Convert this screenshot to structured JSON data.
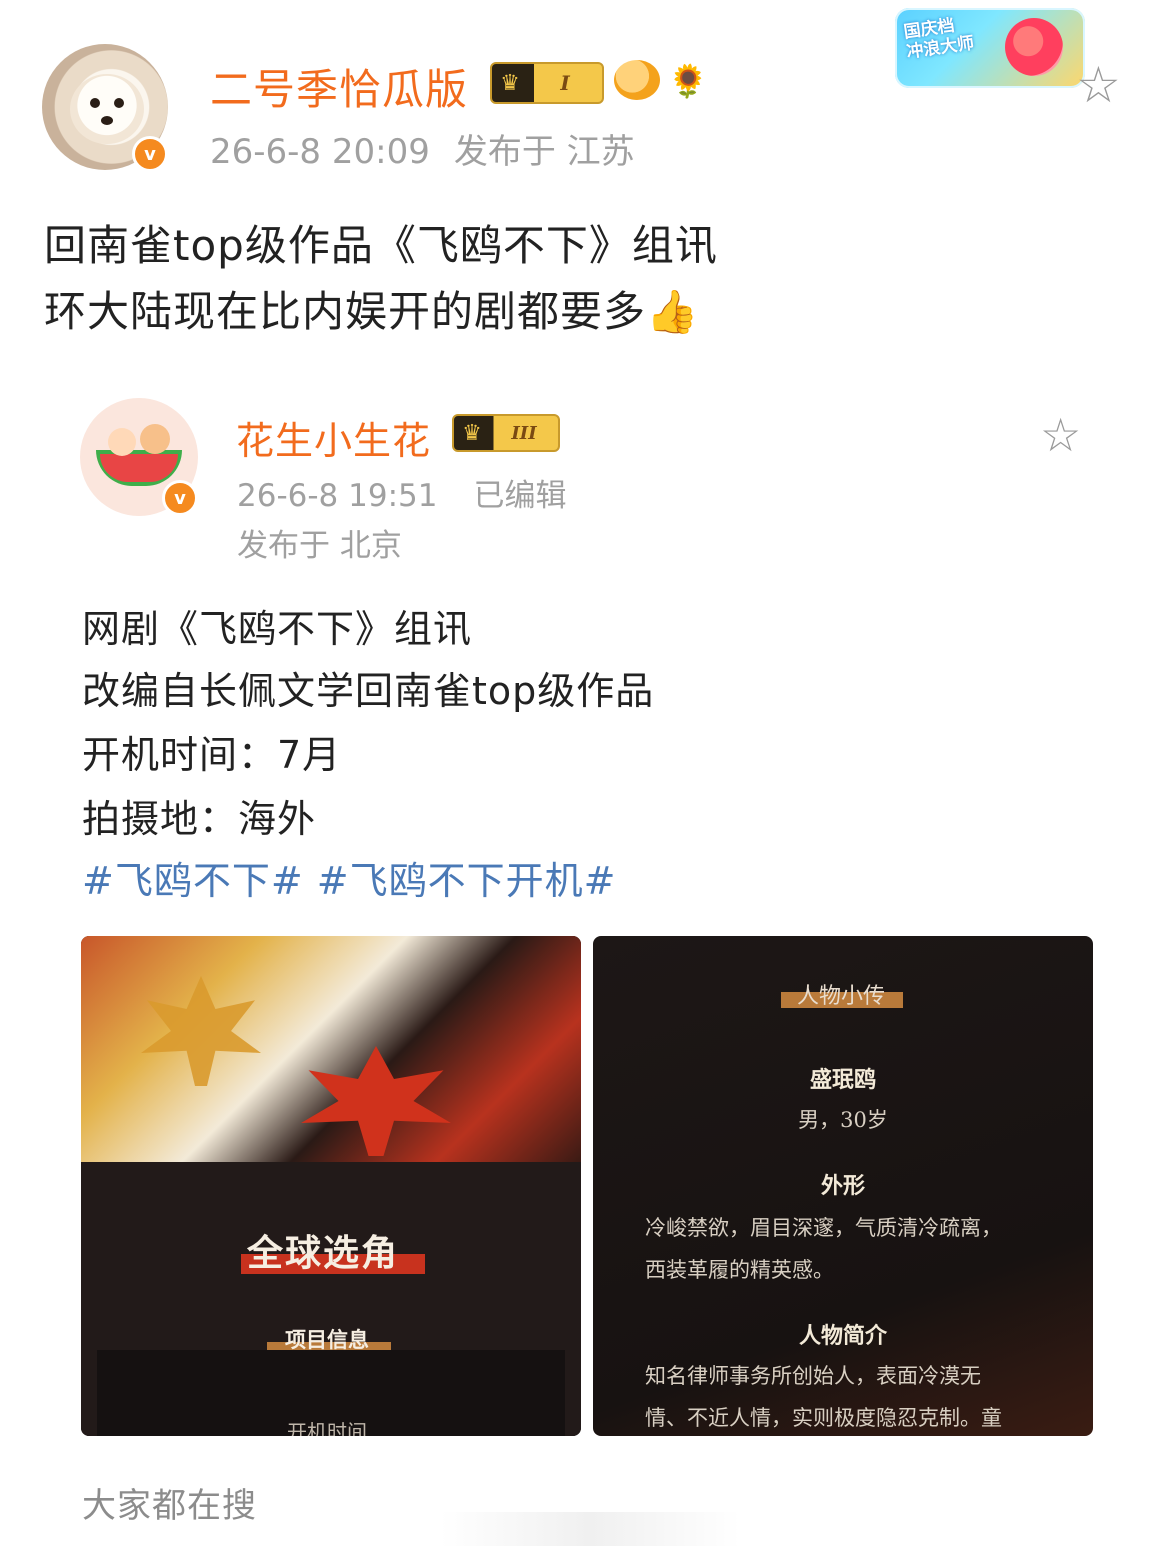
{
  "post": {
    "username": "二号季恰瓜版",
    "level_badge": "I",
    "timestamp": "26-6-8 20:09",
    "location": "发布于 江苏",
    "text_line1": "回南雀top级作品《飞鸥不下》组讯",
    "text_line2": "环大陆现在比内娱开的剧都要多",
    "emoji": "👍",
    "verify_mark": "v"
  },
  "promo": {
    "text_line1": "国庆档",
    "text_line2": "冲浪大师"
  },
  "repost": {
    "username": "花生小生花",
    "level_badge": "III",
    "timestamp": "26-6-8 19:51",
    "edited": "已编辑",
    "location": "发布于 北京",
    "lines": [
      "网剧《飞鸥不下》组讯",
      "改编自长佩文学回南雀top级作品",
      "开机时间：7月",
      "拍摄地：海外"
    ],
    "hashtags": [
      "#飞鸥不下#",
      "#飞鸥不下开机#"
    ],
    "verify_mark": "v"
  },
  "image_left": {
    "title": "全球选角",
    "section": "项目信息",
    "partial_text": "开机时间"
  },
  "image_right": {
    "section": "人物小传",
    "character_name": "盛珉鸥",
    "character_info": "男，30岁",
    "appearance_heading": "外形",
    "appearance_line1": "冷峻禁欲，眉目深邃，气质清冷疏离，",
    "appearance_line2": "西装革履的精英感。",
    "bio_heading": "人物简介",
    "bio_line1": "知名律师事务所创始人，表面冷漠无",
    "bio_line2": "情、不近人情，实则极度隐忍克制。童"
  },
  "footer": {
    "search_label": "大家都在搜"
  },
  "colors": {
    "username": "#f26b1d",
    "hashtag": "#4a79b6",
    "meta": "#a0a0a0",
    "verify": "#f58a1f"
  }
}
